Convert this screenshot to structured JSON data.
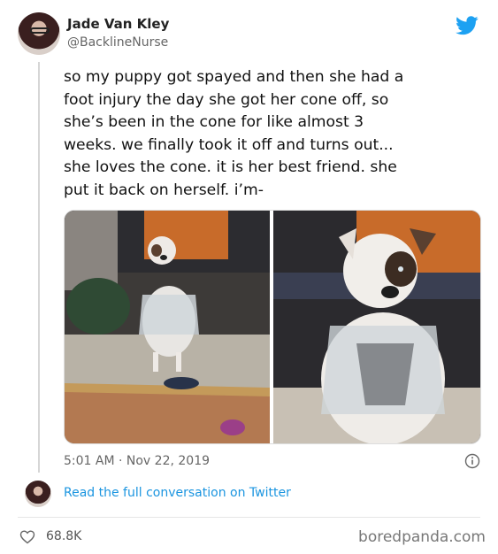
{
  "author": {
    "name": "Jade Van Kley",
    "handle": "@BacklineNurse"
  },
  "tweet": {
    "text": "so my puppy got spayed and then she had a\nfoot injury the day she got her cone off, so\nshe’s been in the cone for like almost 3\nweeks. we finally took it off and turns out...\nshe loves the cone. it is her best friend. she\nput it back on herself. i’m-",
    "timestamp": "5:01 AM · Nov 22, 2019"
  },
  "actions": {
    "read_conversation": "Read the full conversation on Twitter",
    "likes": "68.8K"
  },
  "watermark": "boredpanda.com",
  "icons": {
    "brand": "twitter-bird-icon",
    "info": "info-icon",
    "like": "heart-icon"
  },
  "colors": {
    "accent": "#1b95e0",
    "bird": "#1da1f2",
    "text": "#111111",
    "muted": "#666666"
  }
}
